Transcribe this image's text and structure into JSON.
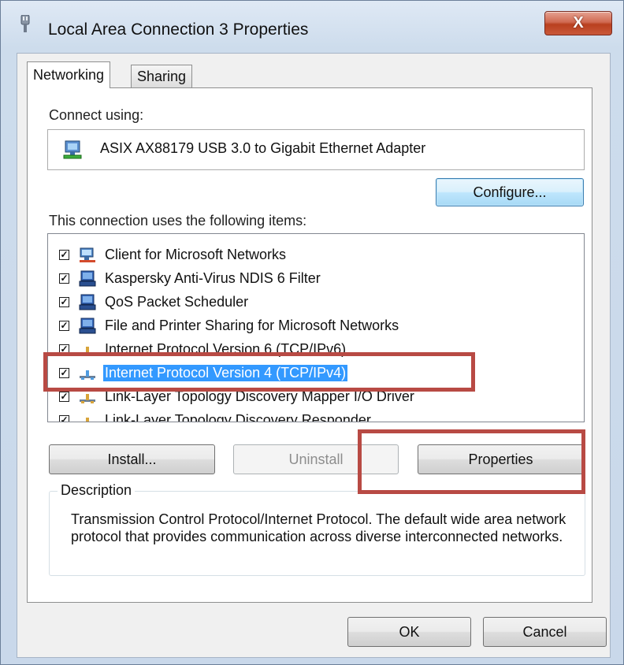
{
  "window": {
    "title": "Local Area Connection 3 Properties",
    "close_glyph": "X"
  },
  "tabs": [
    {
      "label": "Networking",
      "active": true
    },
    {
      "label": "Sharing",
      "active": false
    }
  ],
  "connect_using": {
    "label": "Connect using:",
    "adapter": "ASIX AX88179 USB 3.0 to Gigabit Ethernet Adapter",
    "adapter_icon": "network-adapter-icon"
  },
  "configure_label": "Configure...",
  "items_label": "This connection uses the following items:",
  "items": [
    {
      "label": "Client for Microsoft Networks",
      "checked": true,
      "icon": "client-network-icon"
    },
    {
      "label": "Kaspersky Anti-Virus NDIS 6 Filter",
      "checked": true,
      "icon": "service-icon"
    },
    {
      "label": "QoS Packet Scheduler",
      "checked": true,
      "icon": "service-icon"
    },
    {
      "label": "File and Printer Sharing for Microsoft Networks",
      "checked": true,
      "icon": "service-icon"
    },
    {
      "label": "Internet Protocol Version 6 (TCP/IPv6)",
      "checked": true,
      "icon": "protocol-icon"
    },
    {
      "label": "Internet Protocol Version 4 (TCP/IPv4)",
      "checked": true,
      "icon": "protocol-icon",
      "selected": true
    },
    {
      "label": "Link-Layer Topology Discovery Mapper I/O Driver",
      "checked": true,
      "icon": "protocol-icon"
    },
    {
      "label": "Link-Layer Topology Discovery Responder",
      "checked": true,
      "icon": "protocol-icon"
    }
  ],
  "buttons": {
    "install": "Install...",
    "uninstall": "Uninstall",
    "properties": "Properties",
    "ok": "OK",
    "cancel": "Cancel"
  },
  "description": {
    "title": "Description",
    "text": "Transmission Control Protocol/Internet Protocol. The default wide area network protocol that provides communication across diverse interconnected networks."
  },
  "colors": {
    "selection": "#3399ff",
    "annotation_box": "#b84a44",
    "close_button": "#c9583a"
  }
}
